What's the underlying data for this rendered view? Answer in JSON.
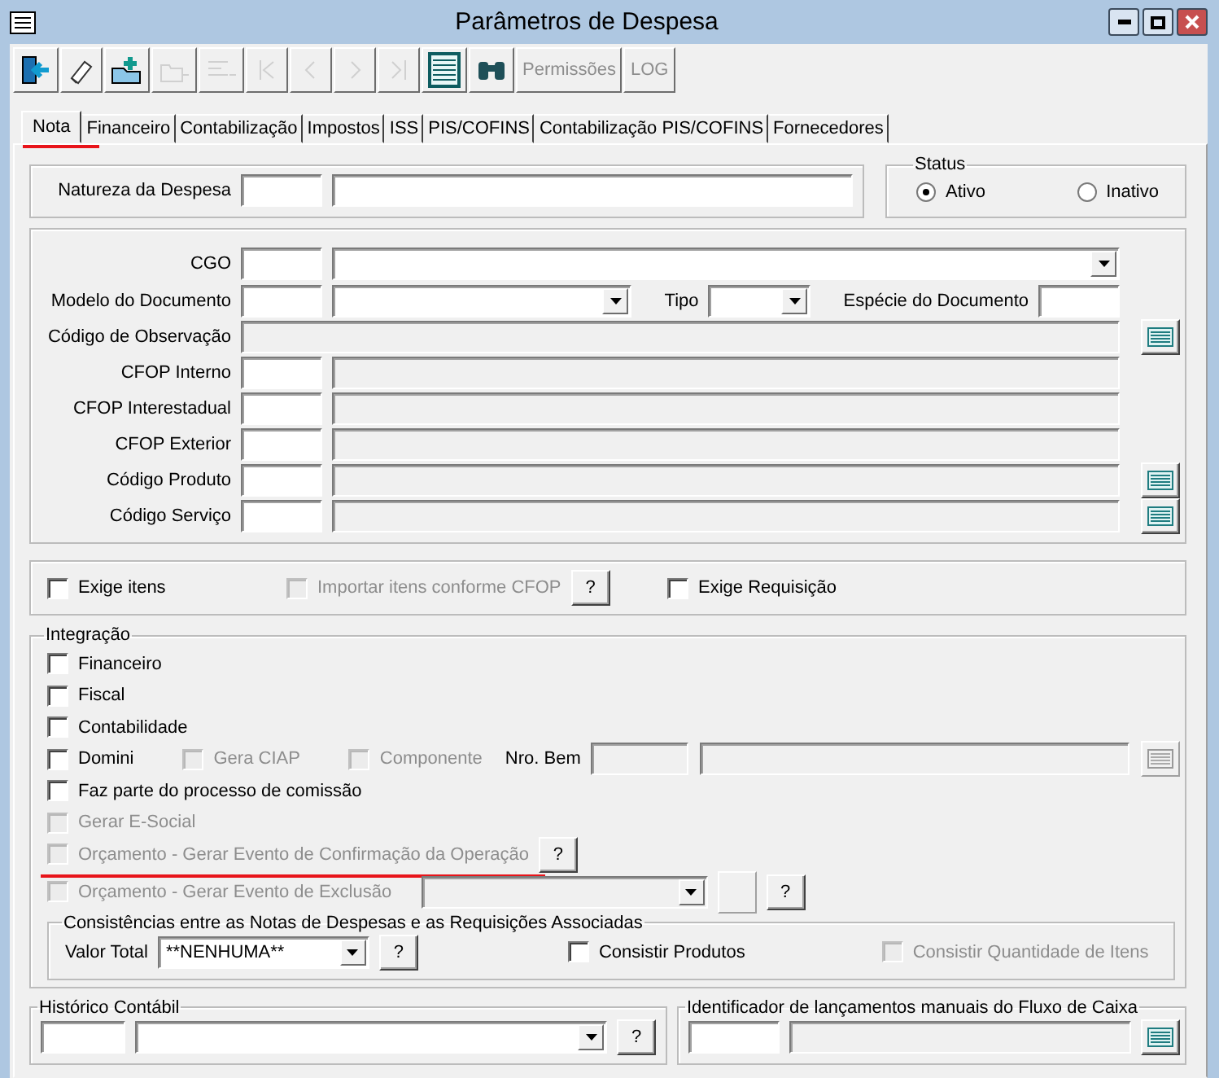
{
  "window": {
    "title": "Parâmetros de Despesa"
  },
  "toolbar": [
    {
      "kind": "exit",
      "disabled": false
    },
    {
      "kind": "eraser",
      "disabled": false
    },
    {
      "kind": "folder_add",
      "disabled": false
    },
    {
      "kind": "tree",
      "disabled": true
    },
    {
      "kind": "tree_lines",
      "disabled": true
    },
    {
      "kind": "first",
      "disabled": true
    },
    {
      "kind": "prev",
      "disabled": true
    },
    {
      "kind": "next",
      "disabled": true
    },
    {
      "kind": "last",
      "disabled": true
    },
    {
      "kind": "grid",
      "disabled": false
    },
    {
      "kind": "binoculars",
      "disabled": false
    },
    {
      "kind": "text",
      "label": "Permissões",
      "disabled": true
    },
    {
      "kind": "text",
      "label": "LOG",
      "disabled": true
    }
  ],
  "tabs": [
    {
      "label": "Nota",
      "selected": true,
      "underlined": true
    },
    {
      "label": "Financeiro",
      "selected": false,
      "underlined": false
    },
    {
      "label": "Contabilização",
      "selected": false,
      "underlined": false
    },
    {
      "label": "Impostos",
      "selected": false,
      "underlined": false
    },
    {
      "label": "ISS",
      "selected": false,
      "underlined": false
    },
    {
      "label": "PIS/COFINS",
      "selected": false,
      "underlined": false
    },
    {
      "label": "Contabilização PIS/COFINS",
      "selected": false,
      "underlined": false
    },
    {
      "label": "Fornecedores",
      "selected": false,
      "underlined": false
    }
  ],
  "natureza": {
    "label": "Natureza da Despesa"
  },
  "status": {
    "title": "Status",
    "options": [
      {
        "label": "Ativo",
        "selected": true
      },
      {
        "label": "Inativo",
        "selected": false
      }
    ]
  },
  "document": {
    "rows": [
      {
        "label": "CGO",
        "lookup": false,
        "parts": [
          {
            "kind": "code"
          },
          {
            "kind": "combo"
          }
        ]
      },
      {
        "label": "Modelo do Documento",
        "lookup": false,
        "parts": [
          {
            "kind": "code"
          },
          {
            "kind": "combo"
          },
          {
            "kind": "label",
            "text": "Tipo"
          },
          {
            "kind": "small_combo"
          },
          {
            "kind": "label",
            "text": "Espécie do Documento"
          },
          {
            "kind": "code"
          }
        ]
      },
      {
        "label": "Código de Observação",
        "lookup": true,
        "parts": [
          {
            "kind": "readonly"
          }
        ]
      },
      {
        "label": "CFOP Interno",
        "lookup": false,
        "parts": [
          {
            "kind": "code"
          },
          {
            "kind": "readonly"
          }
        ]
      },
      {
        "label": "CFOP Interestadual",
        "lookup": false,
        "parts": [
          {
            "kind": "code"
          },
          {
            "kind": "readonly"
          }
        ]
      },
      {
        "label": "CFOP Exterior",
        "lookup": false,
        "parts": [
          {
            "kind": "code"
          },
          {
            "kind": "readonly"
          }
        ]
      },
      {
        "label": "Código Produto",
        "lookup": true,
        "parts": [
          {
            "kind": "code"
          },
          {
            "kind": "readonly"
          }
        ]
      },
      {
        "label": "Código Serviço",
        "lookup": true,
        "parts": [
          {
            "kind": "code"
          },
          {
            "kind": "readonly"
          }
        ]
      }
    ]
  },
  "flags": [
    {
      "label": "Exige itens",
      "checked": false,
      "disabled": false
    },
    {
      "label": "Importar itens conforme CFOP",
      "checked": false,
      "disabled": true,
      "help": "?"
    },
    {
      "label": "Exige Requisição",
      "checked": false,
      "disabled": false
    }
  ],
  "integracao": {
    "title": "Integração",
    "items": [
      {
        "label": "Financeiro",
        "checked": false,
        "disabled": false,
        "underlined": false
      },
      {
        "label": "Fiscal",
        "checked": false,
        "disabled": false,
        "underlined": false
      },
      {
        "label": "Contabilidade",
        "checked": false,
        "disabled": false,
        "underlined": false
      },
      {
        "label": "Domini",
        "checked": false,
        "disabled": false,
        "underlined": false,
        "extras": [
          {
            "kind": "check",
            "label": "Gera CIAP",
            "checked": false,
            "disabled": true
          },
          {
            "kind": "check",
            "label": "Componente",
            "checked": false,
            "disabled": true
          },
          {
            "kind": "label",
            "text": "Nro. Bem"
          },
          {
            "kind": "field",
            "disabled": true
          },
          {
            "kind": "wide_field",
            "disabled": true
          },
          {
            "kind": "lookup",
            "disabled": true
          }
        ]
      },
      {
        "label": "Faz parte do processo de comissão",
        "checked": false,
        "disabled": false,
        "underlined": false
      },
      {
        "label": "Gerar E-Social",
        "checked": false,
        "disabled": true,
        "underlined": false
      },
      {
        "label": "Orçamento - Gerar Evento de Confirmação da Operação",
        "checked": false,
        "disabled": true,
        "underlined": true,
        "extras": [
          {
            "kind": "help",
            "text": "?",
            "disabled": false
          }
        ]
      },
      {
        "label": "Orçamento -  Gerar Evento de Exclusão",
        "checked": false,
        "disabled": true,
        "underlined": false,
        "extras": [
          {
            "kind": "combo",
            "disabled": true
          },
          {
            "kind": "blank_button",
            "disabled": true
          },
          {
            "kind": "help",
            "text": "?",
            "disabled": false
          }
        ]
      }
    ],
    "consistencias": {
      "title": "Consistências entre as Notas de Despesas e as Requisições Associadas",
      "valor_total": {
        "label": "Valor Total",
        "value": "**NENHUMA**",
        "help": "?"
      },
      "checks": [
        {
          "label": "Consistir Produtos",
          "checked": false,
          "disabled": false
        },
        {
          "label": "Consistir Quantidade de Itens",
          "checked": false,
          "disabled": true
        }
      ]
    }
  },
  "historico": {
    "title": "Histórico Contábil",
    "help": "?"
  },
  "identificador": {
    "title": "Identificador de lançamentos manuais do Fluxo de Caixa"
  }
}
